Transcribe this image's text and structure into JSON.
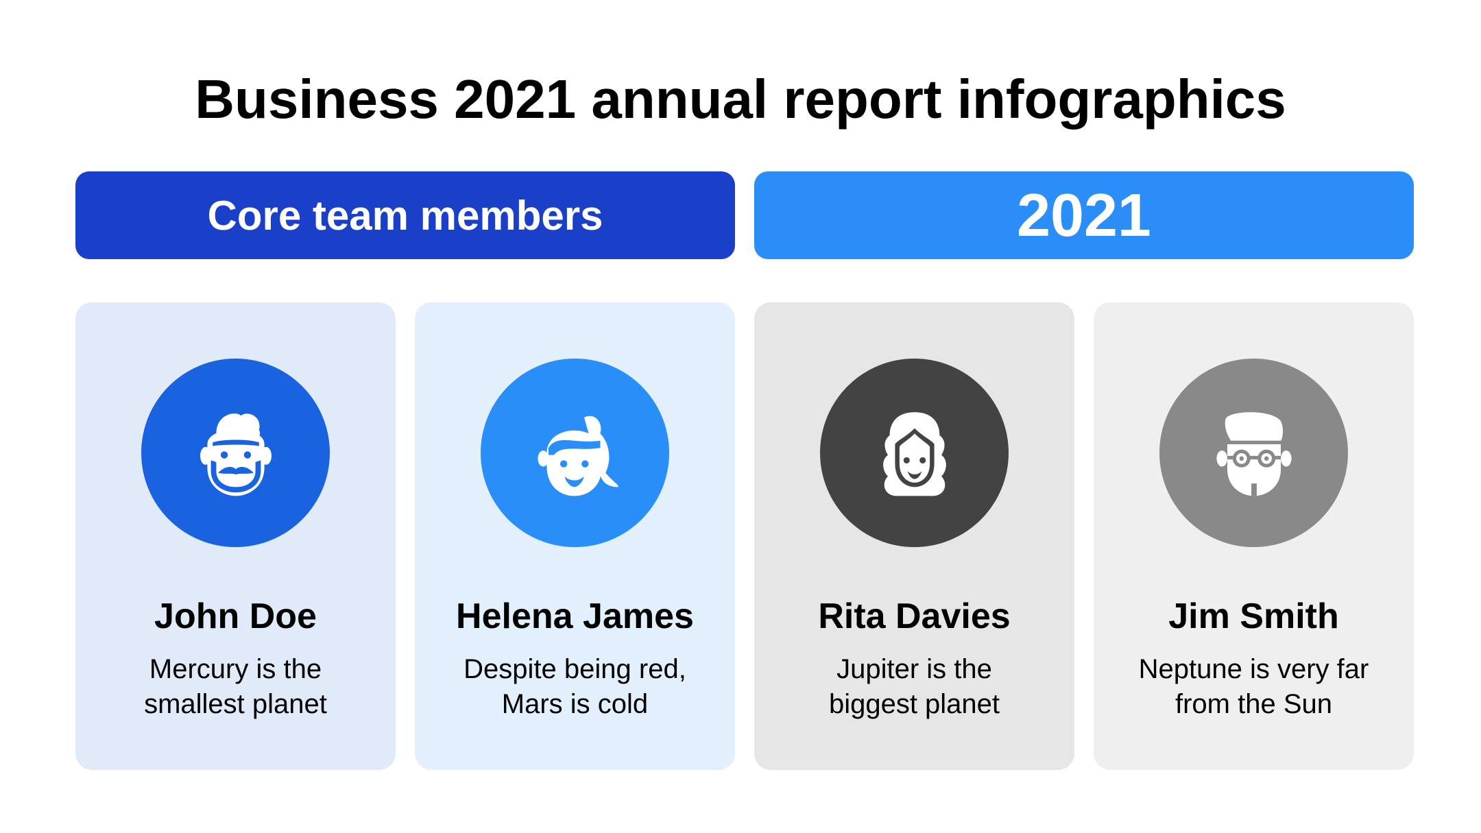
{
  "title": "Business 2021 annual report infographics",
  "banners": {
    "left": {
      "label": "Core team members",
      "color": "#1a3fc9"
    },
    "right": {
      "label": "2021",
      "color": "#2b8ef8"
    }
  },
  "members": [
    {
      "name": "John Doe",
      "desc_lines": [
        "Mercury is the",
        "smallest planet"
      ],
      "card_color": "#e1eaf9",
      "avatar_color": "#1a63e0",
      "icon": "bearded-man-icon"
    },
    {
      "name": "Helena James",
      "desc_lines": [
        "Despite being red,",
        "Mars is cold"
      ],
      "card_color": "#e2effd",
      "avatar_color": "#2a8ef8",
      "icon": "ponytail-woman-icon"
    },
    {
      "name": "Rita Davies",
      "desc_lines": [
        "Jupiter is the",
        "biggest planet"
      ],
      "card_color": "#e6e6e6",
      "avatar_color": "#434343",
      "icon": "curly-hair-woman-icon"
    },
    {
      "name": "Jim Smith",
      "desc_lines": [
        "Neptune is very far",
        "from the Sun"
      ],
      "card_color": "#efefef",
      "avatar_color": "#898989",
      "icon": "man-with-glasses-icon"
    }
  ]
}
